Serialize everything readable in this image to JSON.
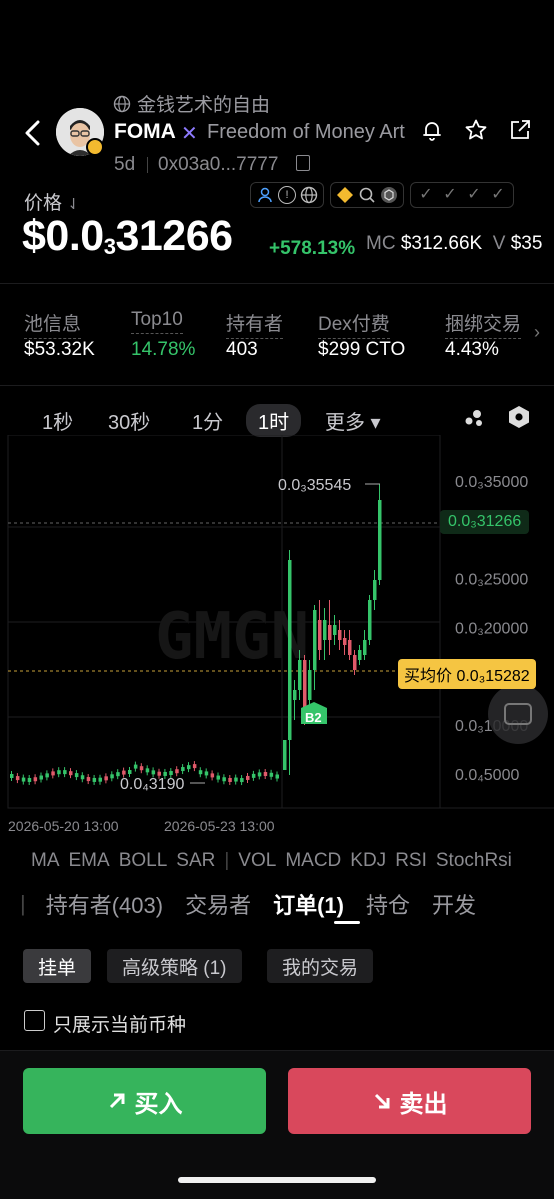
{
  "header": {
    "slogan": "金钱艺术的自由",
    "ticker": "FOMA",
    "x_mark": "✕",
    "full_name": "Freedom of Money Art",
    "age": "5d",
    "address": "0x03a0...7777"
  },
  "price": {
    "label": "价格",
    "prefix": "$0.0",
    "subscript_zeros": "3",
    "digits": "31266",
    "change": "+578.13%",
    "mc_label": "MC",
    "mc_value": "$312.66K",
    "v_label": "V",
    "v_value": "$35"
  },
  "stats": [
    {
      "label": "池信息",
      "value": "$53.32K"
    },
    {
      "label": "Top10",
      "value": "14.78%"
    },
    {
      "label": "持有者",
      "value": "403"
    },
    {
      "label": "Dex付费",
      "value": "$299 CTO"
    },
    {
      "label": "捆绑交易",
      "value": "4.43%"
    }
  ],
  "timeframes": {
    "tf1": "1秒",
    "tf2": "30秒",
    "tf3": "1分",
    "tf4": "1时",
    "more": "更多 ▾",
    "active": "1时"
  },
  "chart_data": {
    "type": "candlestick",
    "y_axis_labels": [
      "0.0₃35000",
      "0.0₃25000",
      "0.0₃20000",
      "0.0₃10000",
      "0.0₄5000"
    ],
    "y_axis_values": [
      0.00035,
      0.00025,
      0.0002,
      0.0001,
      5e-05
    ],
    "current_price_label": "0.0₃31266",
    "high_label": "0.0₃35545",
    "low_label": "0.0₄3190",
    "avg_buy_label": "买均价 0.0₃15282",
    "marker_label": "B2",
    "x_labels": [
      "2026-05-20 13:00",
      "2026-05-23 13:00"
    ],
    "watermark": "GMGN",
    "up_color": "#35c46a",
    "down_color": "#e05a6a"
  },
  "indicators": [
    "MA",
    "EMA",
    "BOLL",
    "SAR",
    "VOL",
    "MACD",
    "KDJ",
    "RSI",
    "StochRsi"
  ],
  "tabs": {
    "holders": "持有者(403)",
    "traders": "交易者",
    "orders": "订单(1)",
    "positions": "持仓",
    "dev": "开发"
  },
  "subtabs": {
    "pending": "挂单",
    "advanced": "高级策略 (1)",
    "mine": "我的交易"
  },
  "filter": {
    "label": "只展示当前币种"
  },
  "actions": {
    "buy": "买入",
    "sell": "卖出"
  },
  "colors": {
    "buy": "#36b45c",
    "sell": "#d9485c",
    "accent": "#35c46a",
    "avg": "#f5c542"
  }
}
